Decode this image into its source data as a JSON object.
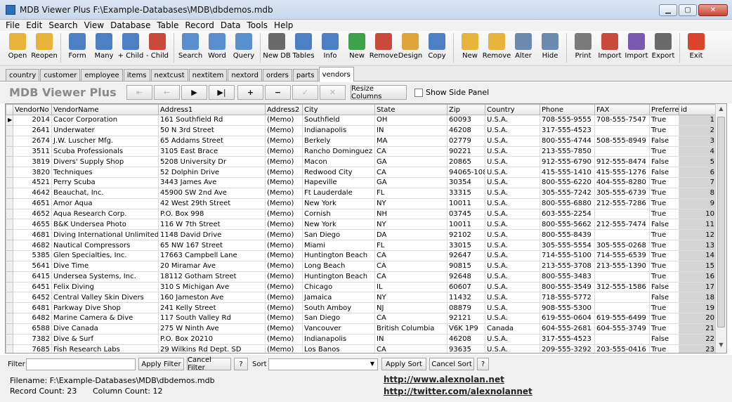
{
  "window": {
    "title": "MDB Viewer Plus F:\\Example-Databases\\MDB\\dbdemos.mdb",
    "minimize": "▁",
    "maximize": "▢",
    "close": "✕"
  },
  "menu": [
    "File",
    "Edit",
    "Search",
    "View",
    "Database",
    "Table",
    "Record",
    "Data",
    "Tools",
    "Help"
  ],
  "toolbar": [
    {
      "label": "Open",
      "icon": "folder-open-icon",
      "color": "#e8b339"
    },
    {
      "label": "Reopen",
      "icon": "folder-reopen-icon",
      "color": "#e8b339"
    },
    {
      "sep": true
    },
    {
      "label": "Form",
      "icon": "form-icon",
      "color": "#4d7fc4"
    },
    {
      "label": "Many",
      "icon": "grid-many-icon",
      "color": "#4d7fc4"
    },
    {
      "label": "+ Child",
      "icon": "add-child-icon",
      "color": "#4d7fc4"
    },
    {
      "label": "- Child",
      "icon": "remove-child-icon",
      "color": "#c94a3a"
    },
    {
      "sep": true
    },
    {
      "label": "Search",
      "icon": "search-icon",
      "color": "#5a8fcf"
    },
    {
      "label": "Word",
      "icon": "word-search-icon",
      "color": "#5a8fcf"
    },
    {
      "label": "Query",
      "icon": "query-icon",
      "color": "#5a8fcf"
    },
    {
      "sep": true
    },
    {
      "label": "New DB",
      "icon": "new-db-icon",
      "color": "#6a6a6a"
    },
    {
      "label": "Tables",
      "icon": "tables-icon",
      "color": "#4d7fc4"
    },
    {
      "label": "Info",
      "icon": "info-icon",
      "color": "#4d7fc4"
    },
    {
      "label": "New",
      "icon": "new-table-icon",
      "color": "#3da34a"
    },
    {
      "label": "Remove",
      "icon": "remove-table-icon",
      "color": "#c94a3a"
    },
    {
      "label": "Design",
      "icon": "design-icon",
      "color": "#e0a53a"
    },
    {
      "label": "Copy",
      "icon": "copy-icon",
      "color": "#4d7fc4"
    },
    {
      "sep": true
    },
    {
      "label": "New",
      "icon": "new-index-icon",
      "color": "#e8b339"
    },
    {
      "label": "Remove",
      "icon": "remove-index-icon",
      "color": "#e8b339"
    },
    {
      "label": "Alter",
      "icon": "alter-icon",
      "color": "#6a8ab0"
    },
    {
      "label": "Hide",
      "icon": "hide-icon",
      "color": "#6a8ab0"
    },
    {
      "sep": true
    },
    {
      "label": "Print",
      "icon": "printer-icon",
      "color": "#7a7a7a"
    },
    {
      "label": "Import",
      "icon": "import-icon",
      "color": "#c94a3a"
    },
    {
      "label": "Import",
      "icon": "import-db-icon",
      "color": "#7a5ab0"
    },
    {
      "label": "Export",
      "icon": "export-icon",
      "color": "#6a6a6a"
    },
    {
      "sep": true
    },
    {
      "label": "Exit",
      "icon": "exit-icon",
      "color": "#d9442b"
    }
  ],
  "tabs": [
    "country",
    "customer",
    "employee",
    "items",
    "nextcust",
    "nextitem",
    "nextord",
    "orders",
    "parts",
    "vendors"
  ],
  "active_tab": "vendors",
  "brand": "MDB Viewer Plus",
  "nav": {
    "first": "⇤",
    "prev": "←",
    "play": "▶",
    "last": "▶|",
    "add": "+",
    "delete": "−",
    "post": "✓",
    "cancel": "✕"
  },
  "resize_label": "Resize Columns",
  "side_panel_label": "Show Side Panel",
  "columns": [
    "VendorNo",
    "VendorName",
    "Address1",
    "Address2",
    "City",
    "State",
    "Zip",
    "Country",
    "Phone",
    "FAX",
    "Preferred",
    "id"
  ],
  "rows": [
    [
      "2014",
      "Cacor Corporation",
      "161 Southfield Rd",
      "(Memo)",
      "Southfield",
      "OH",
      "60093",
      "U.S.A.",
      "708-555-9555",
      "708-555-7547",
      "True",
      "1"
    ],
    [
      "2641",
      "Underwater",
      "50 N 3rd Street",
      "(Memo)",
      "Indianapolis",
      "IN",
      "46208",
      "U.S.A.",
      "317-555-4523",
      "",
      "True",
      "2"
    ],
    [
      "2674",
      "J.W. Luscher Mfg.",
      "65 Addams Street",
      "(Memo)",
      "Berkely",
      "MA",
      "02779",
      "U.S.A.",
      "800-555-4744",
      "508-555-8949",
      "False",
      "3"
    ],
    [
      "3511",
      "Scuba Professionals",
      "3105 East Brace",
      "(Memo)",
      "Rancho Dominguez",
      "CA",
      "90221",
      "U.S.A.",
      "213-555-7850",
      "",
      "True",
      "4"
    ],
    [
      "3819",
      "Divers'  Supply Shop",
      "5208 University Dr",
      "(Memo)",
      "Macon",
      "GA",
      "20865",
      "U.S.A.",
      "912-555-6790",
      "912-555-8474",
      "False",
      "5"
    ],
    [
      "3820",
      "Techniques",
      "52 Dolphin Drive",
      "(Memo)",
      "Redwood City",
      "CA",
      "94065-1086",
      "U.S.A.",
      "415-555-1410",
      "415-555-1276",
      "False",
      "6"
    ],
    [
      "4521",
      "Perry Scuba",
      "3443 James Ave",
      "(Memo)",
      "Hapeville",
      "GA",
      "30354",
      "U.S.A.",
      "800-555-6220",
      "404-555-8280",
      "True",
      "7"
    ],
    [
      "4642",
      "Beauchat, Inc.",
      "45900 SW 2nd Ave",
      "(Memo)",
      "Ft Lauderdale",
      "FL",
      "33315",
      "U.S.A.",
      "305-555-7242",
      "305-555-6739",
      "True",
      "8"
    ],
    [
      "4651",
      "Amor Aqua",
      "42 West 29th Street",
      "(Memo)",
      "New York",
      "NY",
      "10011",
      "U.S.A.",
      "800-555-6880",
      "212-555-7286",
      "True",
      "9"
    ],
    [
      "4652",
      "Aqua Research Corp.",
      "P.O. Box 998",
      "(Memo)",
      "Cornish",
      "NH",
      "03745",
      "U.S.A.",
      "603-555-2254",
      "",
      "True",
      "10"
    ],
    [
      "4655",
      "B&K Undersea Photo",
      "116 W 7th Street",
      "(Memo)",
      "New York",
      "NY",
      "10011",
      "U.S.A.",
      "800-555-5662",
      "212-555-7474",
      "False",
      "11"
    ],
    [
      "4681",
      "Diving International Unlimited",
      "1148 David Drive",
      "(Memo)",
      "San Diego",
      "DA",
      "92102",
      "U.S.A.",
      "800-555-8439",
      "",
      "True",
      "12"
    ],
    [
      "4682",
      "Nautical Compressors",
      "65 NW 167 Street",
      "(Memo)",
      "Miami",
      "FL",
      "33015",
      "U.S.A.",
      "305-555-5554",
      "305-555-0268",
      "True",
      "13"
    ],
    [
      "5385",
      "Glen Specialties, Inc.",
      "17663 Campbell Lane",
      "(Memo)",
      "Huntington Beach",
      "CA",
      "92647",
      "U.S.A.",
      "714-555-5100",
      "714-555-6539",
      "True",
      "14"
    ],
    [
      "5641",
      "Dive Time",
      "20 Miramar Ave",
      "(Memo)",
      "Long Beach",
      "CA",
      "90815",
      "U.S.A.",
      "213-555-3708",
      "213-555-1390",
      "True",
      "15"
    ],
    [
      "6415",
      "Undersea Systems, Inc.",
      "18112 Gotham Street",
      "(Memo)",
      "Huntington Beach",
      "CA",
      "92648",
      "U.S.A.",
      "800-555-3483",
      "",
      "True",
      "16"
    ],
    [
      "6451",
      "Felix Diving",
      "310 S Michigan Ave",
      "(Memo)",
      "Chicago",
      "IL",
      "60607",
      "U.S.A.",
      "800-555-3549",
      "312-555-1586",
      "False",
      "17"
    ],
    [
      "6452",
      "Central Valley Skin Divers",
      "160 Jameston Ave",
      "(Memo)",
      "Jamaica",
      "NY",
      "11432",
      "U.S.A.",
      "718-555-5772",
      "",
      "False",
      "18"
    ],
    [
      "6481",
      "Parkway Dive Shop",
      "241 Kelly Street",
      "(Memo)",
      "South Amboy",
      "NJ",
      "08879",
      "U.S.A.",
      "908-555-5300",
      "",
      "True",
      "19"
    ],
    [
      "6482",
      "Marine Camera & Dive",
      "117 South Valley Rd",
      "(Memo)",
      "San Diego",
      "CA",
      "92121",
      "U.S.A.",
      "619-555-0604",
      "619-555-6499",
      "True",
      "20"
    ],
    [
      "6588",
      "Dive Canada",
      "275 W Ninth Ave",
      "(Memo)",
      "Vancouver",
      "British Columbia",
      "V6K 1P9",
      "Canada",
      "604-555-2681",
      "604-555-3749",
      "True",
      "21"
    ],
    [
      "7382",
      "Dive & Surf",
      "P.O. Box 20210",
      "(Memo)",
      "Indianapolis",
      "IN",
      "46208",
      "U.S.A.",
      "317-555-4523",
      "",
      "False",
      "22"
    ],
    [
      "7685",
      "Fish Research Labs",
      "29 Wilkins Rd Dept. SD",
      "(Memo)",
      "Los Banos",
      "CA",
      "93635",
      "U.S.A.",
      "209-555-3292",
      "203-555-0416",
      "True",
      "23"
    ]
  ],
  "filter": {
    "label": "Filter",
    "apply": "Apply Filter",
    "cancel": "Cancel Filter",
    "help": "?",
    "sort_label": "Sort",
    "apply_sort": "Apply Sort",
    "cancel_sort": "Cancel Sort",
    "sort_help": "?"
  },
  "status": {
    "filename": "Filename: F:\\Example-Databases\\MDB\\dbdemos.mdb",
    "records": "Record Count: 23",
    "columns": "Column Count: 12",
    "link1": "http://www.alexnolan.net",
    "link2": "http://twitter.com/alexnolannet"
  }
}
